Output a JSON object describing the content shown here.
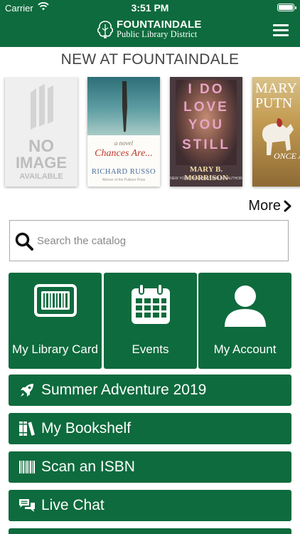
{
  "status_bar": {
    "carrier": "Carrier",
    "time": "3:51 PM"
  },
  "header": {
    "logo_line1": "FOUNTAINDALE",
    "logo_line2": "Public Library District",
    "menu_icon": "hamburger-menu-icon"
  },
  "section_title": "NEW AT FOUNTAINDALE",
  "books": [
    {
      "placeholder_lines": [
        "NO",
        "IMAGE",
        "AVAILABLE"
      ]
    },
    {
      "subtitle": "a novel",
      "title": "Chances Are...",
      "author": "RICHARD RUSSO",
      "tagline": "Winner of the Pulitzer Prize"
    },
    {
      "title_lines": [
        "I DO",
        "LOVE",
        "YOU",
        "STILL"
      ],
      "author": "MARY B. MORRISON",
      "tagline": "NEW YORK TIMES BESTSELLING AUTHOR"
    },
    {
      "author_lines": [
        "MARY",
        "PUTN"
      ],
      "title": "ONCE A"
    }
  ],
  "more_label": "More",
  "search": {
    "placeholder": "Search the catalog",
    "value": ""
  },
  "tiles": [
    {
      "label": "My Library Card",
      "icon": "barcode-card-icon"
    },
    {
      "label": "Events",
      "icon": "calendar-icon"
    },
    {
      "label": "My Account",
      "icon": "user-icon"
    }
  ],
  "bars": [
    {
      "label": "Summer Adventure 2019",
      "icon": "rocket-icon"
    },
    {
      "label": "My Bookshelf",
      "icon": "books-icon"
    },
    {
      "label": "Scan an ISBN",
      "icon": "barcode-icon"
    },
    {
      "label": "Live Chat",
      "icon": "chat-bubbles-icon"
    }
  ],
  "colors": {
    "brand_green": "#0e6b3d",
    "text_dark": "#111111",
    "title_gray": "#444444"
  }
}
